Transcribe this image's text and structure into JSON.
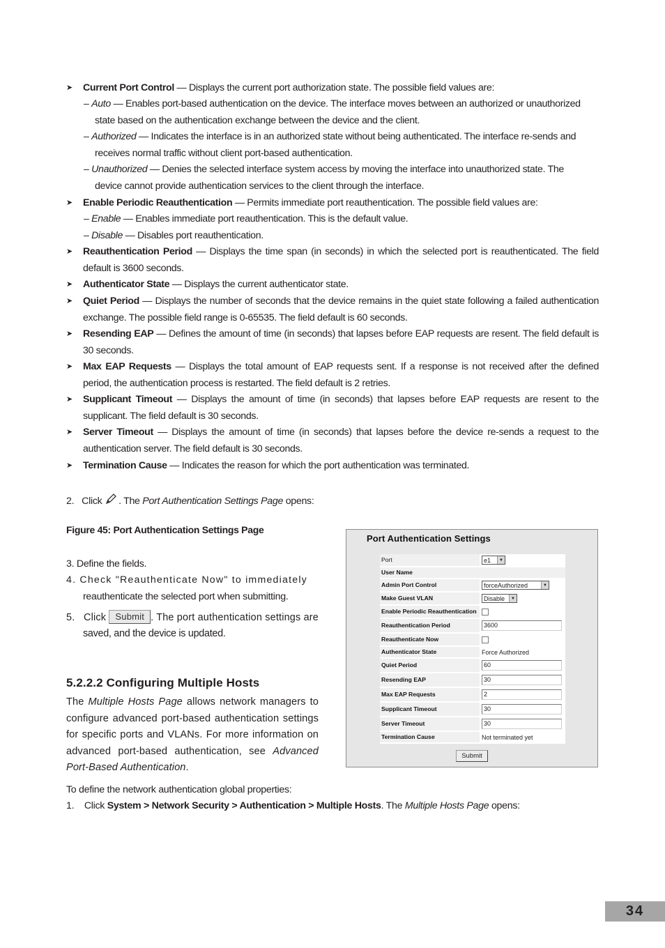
{
  "bullets": [
    {
      "term": "Current Port Control",
      "desc": " — Displays the current port authorization state. The possible field values are:",
      "subs": [
        {
          "term": "Auto",
          "desc": " — Enables port-based authentication on the device. The interface moves between an authorized or unauthorized",
          "cont": "state based on the authentication exchange between the device and the client."
        },
        {
          "term": "Authorized",
          "desc": " — Indicates the interface is in an authorized state without being authenticated. The interface re-sends and",
          "cont": "receives normal traffic without client port-based authentication."
        },
        {
          "term": "Unauthorized",
          "desc": " — Denies the selected interface system access by moving the interface into unauthorized state. The",
          "cont": "device cannot provide authentication services to the client through the interface."
        }
      ]
    },
    {
      "term": "Enable Periodic Reauthentication",
      "desc": " — Permits immediate port reauthentication. The possible field values are:",
      "subs": [
        {
          "term": "Enable",
          "desc": " — Enables immediate port reauthentication. This is the default value."
        },
        {
          "term": "Disable",
          "desc": " — Disables port reauthentication."
        }
      ]
    },
    {
      "term": "Reauthentication Period",
      "desc": " — Displays the time span (in seconds) in which the selected port is reauthenticated. The field default is 3600 seconds."
    },
    {
      "term": "Authenticator State",
      "desc": " — Displays the current authenticator state."
    },
    {
      "term": "Quiet Period",
      "desc": " — Displays the number of seconds that the device remains in the quiet state following a failed authentication exchange. The possible field range is 0-65535. The field default is 60 seconds."
    },
    {
      "term": "Resending EAP",
      "desc": " — Defines the amount of time (in seconds) that lapses before EAP requests are resent. The field default is 30 seconds."
    },
    {
      "term": "Max EAP Requests",
      "desc": " — Displays the total amount of EAP requests sent. If a response is not received after the defined period, the authentication process is restarted. The field default is 2 retries."
    },
    {
      "term": "Supplicant Timeout",
      "desc": " — Displays the amount of time (in seconds) that lapses before EAP requests are resent to the supplicant. The field default is 30 seconds."
    },
    {
      "term": "Server Timeout",
      "desc": " — Displays the amount of time (in seconds) that lapses before the device re-sends a request to the authentication server. The field default is 30 seconds."
    },
    {
      "term": "Termination Cause",
      "desc": " — Indicates the reason for which the port authentication was terminated."
    }
  ],
  "step2": {
    "num": "2.",
    "pre": "Click",
    "post": ". The ",
    "page": "Port Authentication Settings Page",
    "end": " opens:",
    "icon": "pencil-icon"
  },
  "figure_caption": "Figure 45: Port Authentication Settings Page",
  "step3": "3.   Define the fields.",
  "step4": {
    "line1": "4. Check \"Reauthenticate Now\" to immediately",
    "line2": "reauthenticate the selected port when submitting."
  },
  "step5": {
    "num": "5.",
    "pre": "Click",
    "button": "Submit",
    "post": ". The port authentication settings are",
    "line2": "saved, and the device is updated."
  },
  "section": {
    "title": "5.2.2.2   Configuring Multiple Hosts",
    "p_pre": "The ",
    "p_italic": "Multiple Hosts Page",
    "p_mid": " allows network managers to configure advanced port-based authentication settings for specific ports and VLANs. For more information on advanced port-based authentication, see ",
    "p_link": "Advanced Port-Based Authentication",
    "p_end": "."
  },
  "global_intro": "To define the network authentication global properties:",
  "step1b": {
    "num": "1.",
    "pre": "Click ",
    "path": "System > Network Security > Authentication > Multiple Hosts",
    "mid": ". The ",
    "page": "Multiple Hosts Page",
    "end": " opens:"
  },
  "panel": {
    "title": "Port Authentication Settings",
    "rows": [
      {
        "label": "Port",
        "type": "select",
        "value": "e1"
      },
      {
        "label": "User Name",
        "type": "text",
        "value": ""
      },
      {
        "label": "Admin Port Control",
        "type": "select",
        "value": "forceAuthorized"
      },
      {
        "label": "Make Guest VLAN",
        "type": "select",
        "value": "Disable"
      },
      {
        "label": "Enable Periodic Reauthentication",
        "type": "checkbox",
        "checked": false
      },
      {
        "label": "Reauthentication Period",
        "type": "input",
        "value": "3600"
      },
      {
        "label": "Reauthenticate Now",
        "type": "checkbox",
        "checked": false
      },
      {
        "label": "Authenticator State",
        "type": "text",
        "value": "Force Authorized"
      },
      {
        "label": "Quiet Period",
        "type": "input",
        "value": "60"
      },
      {
        "label": "Resending EAP",
        "type": "input",
        "value": "30"
      },
      {
        "label": "Max EAP Requests",
        "type": "input",
        "value": "2"
      },
      {
        "label": "Supplicant Timeout",
        "type": "input",
        "value": "30"
      },
      {
        "label": "Server Timeout",
        "type": "input",
        "value": "30"
      },
      {
        "label": "Termination Cause",
        "type": "text",
        "value": "Not terminated yet"
      }
    ],
    "submit": "Submit"
  },
  "page_number": "34"
}
